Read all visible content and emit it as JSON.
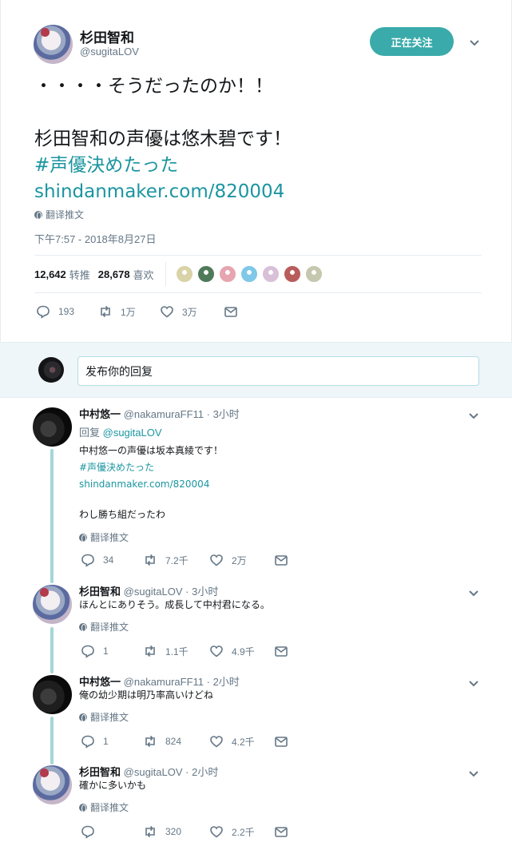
{
  "main_tweet": {
    "author_name": "杉田智和",
    "author_handle": "@sugitaLOV",
    "follow_label": "正在关注",
    "text_lines": [
      "・・・・そうだったのか！！",
      "",
      "杉田智和の声優は悠木碧です！"
    ],
    "hashtag": "#声優決めたった",
    "url": "shindanmaker.com/820004",
    "translate_label": "翻译推文",
    "timestamp": "下午7:57 - 2018年8月27日",
    "retweet_count": "12,642",
    "retweet_label": "转推",
    "like_count": "28,678",
    "like_label": "喜欢",
    "liker_avatar_colors": [
      "#d9d3a7",
      "#4f7a5a",
      "#e6a5b0",
      "#7fc8e8",
      "#d8c0d8",
      "#b85c5c",
      "#c7c7b0"
    ],
    "actions": {
      "replies": "193",
      "retweets": "1万",
      "likes": "3万"
    }
  },
  "reply_box": {
    "placeholder": "发布你的回复"
  },
  "replies": [
    {
      "author_name": "中村悠一",
      "meta": "@nakamuraFF11 · 3小时",
      "reply_to_prefix": "回复 ",
      "reply_to": "@sugitaLOV",
      "lines": [
        "中村悠一の声優は坂本真綾です！"
      ],
      "hashtag": "#声優決めたった",
      "url": "shindanmaker.com/820004",
      "extra_line": "わし勝ち組だったわ",
      "translate_label": "翻译推文",
      "actions": {
        "replies": "34",
        "retweets": "7.2千",
        "likes": "2万"
      }
    },
    {
      "author_name": "杉田智和",
      "meta": "@sugitaLOV · 3小时",
      "lines": [
        "ほんとにありそう。成長して中村君になる。"
      ],
      "translate_label": "翻译推文",
      "actions": {
        "replies": "1",
        "retweets": "1.1千",
        "likes": "4.9千"
      }
    },
    {
      "author_name": "中村悠一",
      "meta": "@nakamuraFF11 · 2小时",
      "lines": [
        "俺の幼少期は明乃率高いけどね"
      ],
      "translate_label": "翻译推文",
      "actions": {
        "replies": "1",
        "retweets": "824",
        "likes": "4.2千"
      }
    },
    {
      "author_name": "杉田智和",
      "meta": "@sugitaLOV · 2小时",
      "lines": [
        "確かに多いかも"
      ],
      "translate_label": "翻译推文",
      "actions": {
        "replies": "",
        "retweets": "320",
        "likes": "2.2千"
      }
    }
  ]
}
